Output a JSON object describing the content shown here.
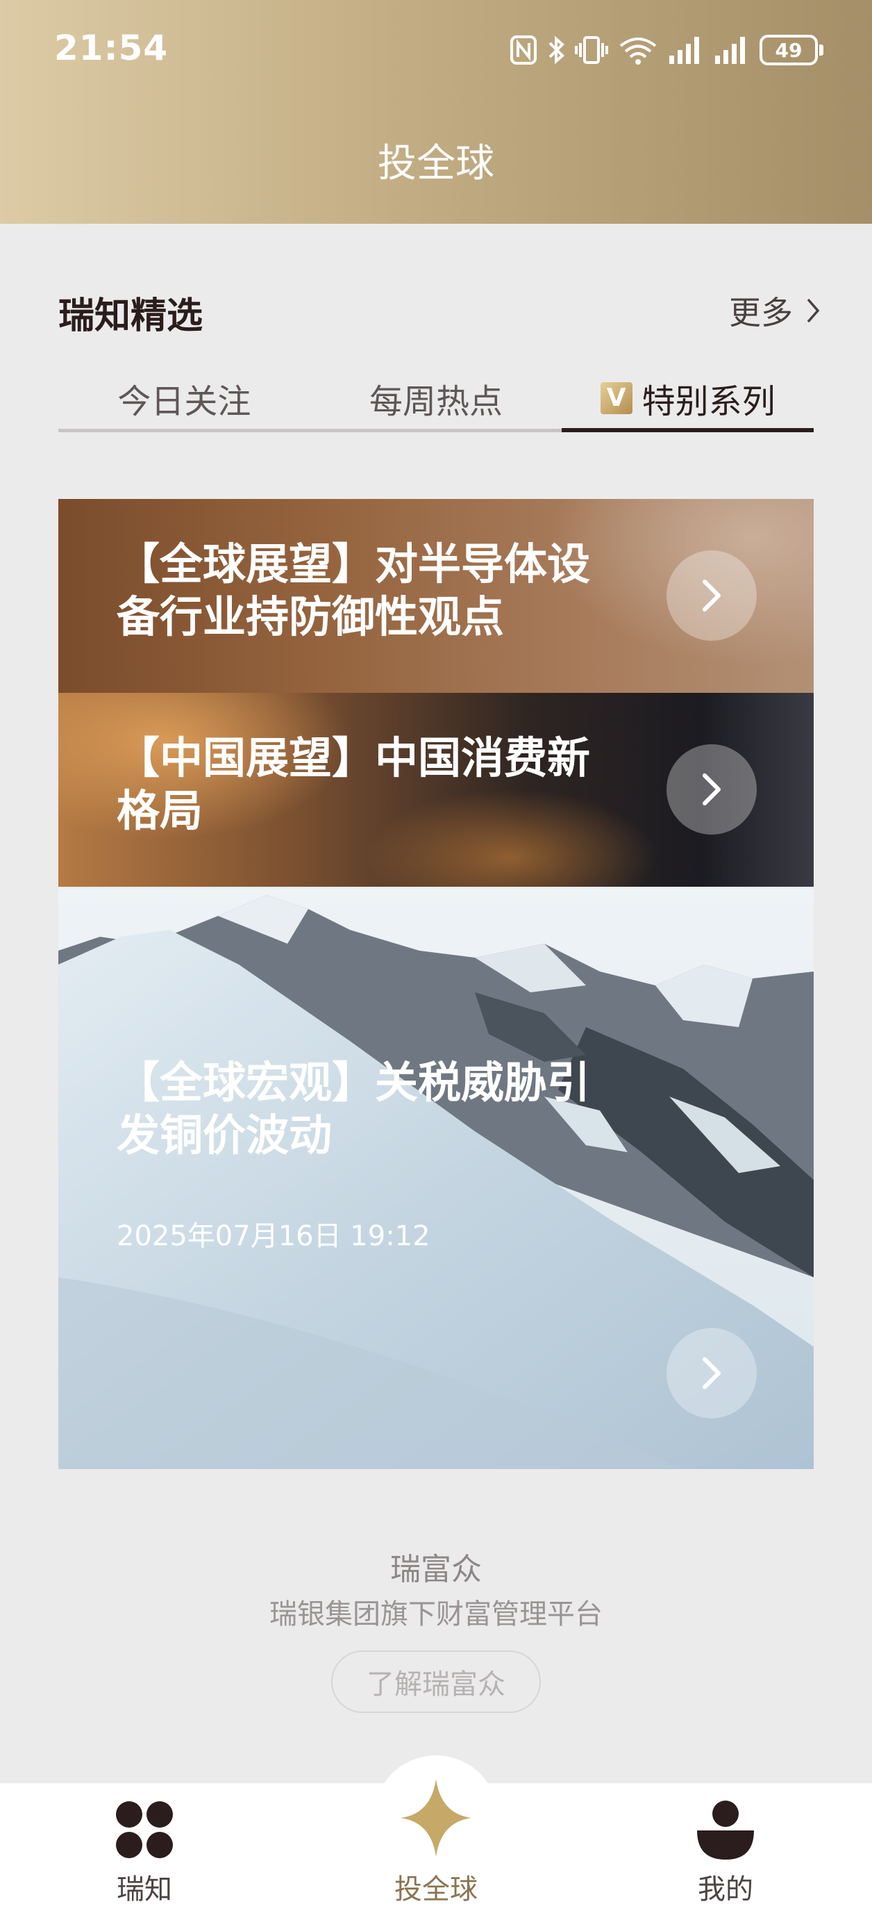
{
  "status_bar": {
    "time": "21:54",
    "battery": "49",
    "icons": [
      "nfc-icon",
      "bluetooth-icon",
      "vibrate-icon",
      "wifi-icon",
      "signal-icon",
      "signal-icon",
      "battery-icon"
    ]
  },
  "header": {
    "title": "投全球"
  },
  "section": {
    "title": "瑞知精选",
    "more": "更多"
  },
  "tabs": [
    {
      "label": "今日关注",
      "active": false
    },
    {
      "label": "每周热点",
      "active": false
    },
    {
      "label": "特别系列",
      "active": true,
      "badge": "V"
    }
  ],
  "cards": [
    {
      "title": "【全球展望】对半导体设备行业持防御性观点"
    },
    {
      "title": "【中国展望】中国消费新格局"
    },
    {
      "title": "【全球宏观】关税威胁引发铜价波动",
      "date": "2025年07月16日 19:12"
    }
  ],
  "footer": {
    "brand": "瑞富众",
    "desc": "瑞银集团旗下财富管理平台",
    "button": "了解瑞富众"
  },
  "bottom_nav": [
    {
      "label": "瑞知",
      "icon": "four-dots-icon",
      "active": false
    },
    {
      "label": "投全球",
      "icon": "star-icon",
      "active": true
    },
    {
      "label": "我的",
      "icon": "person-icon",
      "active": false
    }
  ],
  "colors": {
    "accent_gold": "#c6a968",
    "dark_text": "#2b1d1d",
    "active_nav_label": "#8a7450"
  }
}
